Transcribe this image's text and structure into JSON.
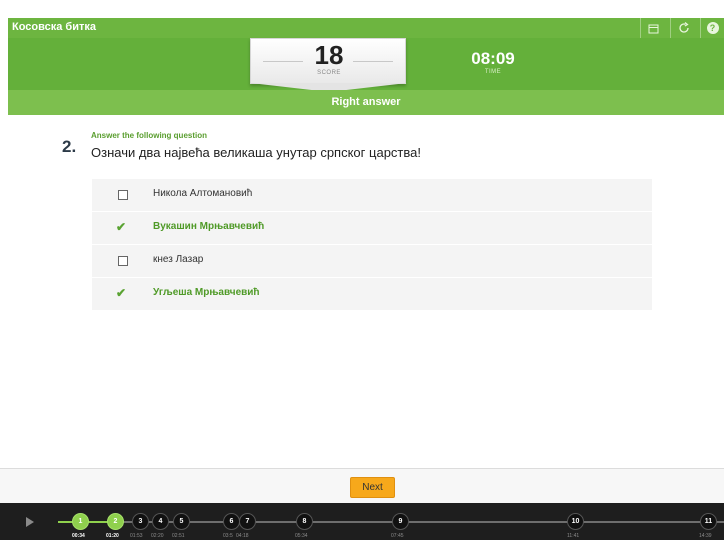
{
  "app": {
    "title": "Косовска битка"
  },
  "toolbar": {
    "icons": [
      "calendar-icon",
      "refresh-icon",
      "help-icon"
    ],
    "help_glyph": "?"
  },
  "score": {
    "value": "18",
    "label": "SCORE"
  },
  "timer": {
    "value": "08:09",
    "label": "TIME"
  },
  "status": {
    "text": "Right answer"
  },
  "question": {
    "number": "2.",
    "caption": "Answer the following question",
    "text": "Означи два највећа великаша унутар српског царства!",
    "options": [
      {
        "label": "Никола Алтомановић",
        "checked": false
      },
      {
        "label": "Вукашин Мрњавчевић",
        "checked": true
      },
      {
        "label": "кнез Лазар",
        "checked": false
      },
      {
        "label": "Угљеша Мрњавчевић",
        "checked": true
      }
    ]
  },
  "footer": {
    "next_label": "Next"
  },
  "timeline": {
    "nodes": [
      "1",
      "2",
      "3",
      "4",
      "5",
      "6",
      "7",
      "8",
      "9",
      "10",
      "11"
    ],
    "completed": [
      "1",
      "2"
    ],
    "times": [
      "00:34",
      "01:20",
      "01:53",
      "02:20",
      "02:51",
      "03:5",
      "04:18",
      "05:34",
      "07:45",
      "11:41",
      "14:39"
    ]
  },
  "colors": {
    "accent": "#64b03a",
    "correct": "#4f9a27",
    "next_button": "#f7a81b",
    "timeline_bg": "#1e1e1e"
  }
}
